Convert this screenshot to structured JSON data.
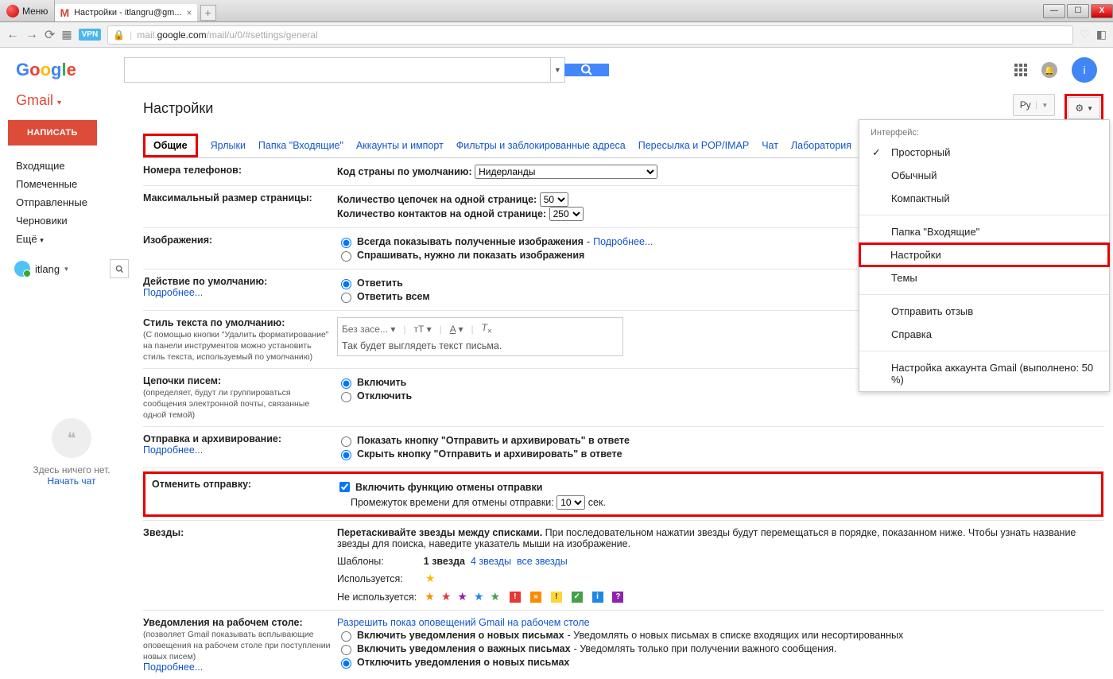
{
  "browser": {
    "menu_label": "Меню",
    "tab_title": "Настройки - itlangru@gm...",
    "url_prefix": "mail.",
    "url_domain": "google.com",
    "url_path": "/mail/u/0/#settings/general",
    "vpn": "VPN"
  },
  "header": {
    "apps_tooltip": "Приложения",
    "avatar_initial": "i"
  },
  "sidebar": {
    "brand": "Gmail",
    "compose": "НАПИСАТЬ",
    "items": [
      "Входящие",
      "Помеченные",
      "Отправленные",
      "Черновики"
    ],
    "more": "Ещё",
    "user": "itlang",
    "hangouts_empty": "Здесь ничего нет.",
    "hangouts_start": "Начать чат"
  },
  "topbar": {
    "title": "Настройки",
    "lang": "Ру"
  },
  "gear_menu": {
    "interface": "Интерфейс:",
    "items1": [
      "Просторный",
      "Обычный",
      "Компактный"
    ],
    "items2": [
      "Папка \"Входящие\"",
      "Настройки",
      "Темы"
    ],
    "items3": [
      "Отправить отзыв",
      "Справка"
    ],
    "items4": "Настройка аккаунта Gmail (выполнено: 50 %)"
  },
  "tabs": [
    "Общие",
    "Ярлыки",
    "Папка \"Входящие\"",
    "Аккаунты и импорт",
    "Фильтры и заблокированные адреса",
    "Пересылка и POP/IMAP",
    "Чат",
    "Лаборатория"
  ],
  "settings": {
    "phone": {
      "label": "Номера телефонов:",
      "code_label": "Код страны по умолчанию:",
      "country": "Нидерланды"
    },
    "pagesize": {
      "label": "Максимальный размер страницы:",
      "threads": "Количество цепочек на одной странице:",
      "threads_v": "50",
      "contacts": "Количество контактов на одной странице:",
      "contacts_v": "250"
    },
    "images": {
      "label": "Изображения:",
      "always": "Всегда показывать полученные изображения",
      "ask": "Спрашивать, нужно ли показать изображения",
      "more": "Подробнее..."
    },
    "default_action": {
      "label": "Действие по умолчанию:",
      "more": "Подробнее...",
      "reply": "Ответить",
      "reply_all": "Ответить всем"
    },
    "text_style": {
      "label": "Стиль текста по умолчанию:",
      "hint": "(С помощью кнопки \"Удалить форматирование\" на панели инструментов можно установить стиль текста, используемый по умолчанию)",
      "font": "Без засе...",
      "sample": "Так будет выглядеть текст письма."
    },
    "threads": {
      "label": "Цепочки писем:",
      "hint": "(определяет, будут ли группироваться сообщения электронной почты, связанные одной темой)",
      "on": "Включить",
      "off": "Отключить"
    },
    "archive": {
      "label": "Отправка и архивирование:",
      "more": "Подробнее...",
      "show": "Показать кнопку \"Отправить и архивировать\" в ответе",
      "hide": "Скрыть кнопку \"Отправить и архивировать\" в ответе"
    },
    "undo": {
      "label": "Отменить отправку:",
      "enable": "Включить функцию отмены отправки",
      "period_label": "Промежуток времени для отмены отправки:",
      "seconds": "10",
      "sec_unit": "сек."
    },
    "stars": {
      "label": "Звезды:",
      "desc1": "Перетаскивайте звезды между списками.",
      "desc2": " При последовательном нажатии звезды будут перемещаться в порядке, показанном ниже. Чтобы узнать название звезды для поиска, наведите указатель мыши на изображение.",
      "templates": "Шаблоны:",
      "one": "1 звезда",
      "four": "4 звезды",
      "all": "все звезды",
      "used": "Используется:",
      "unused": "Не используется:"
    },
    "notifications": {
      "label": "Уведомления на рабочем столе:",
      "hint": "(позволяет Gmail показывать всплывающие оповещения на рабочем столе при поступлении новых писем)",
      "more": "Подробнее...",
      "allow": "Разрешить показ оповещений Gmail на рабочем столе",
      "opt1": "Включить уведомления о новых письмах",
      "opt1_desc": " - Уведомлять о новых письмах в списке входящих или несортированных",
      "opt2": "Включить уведомления о важных письмах",
      "opt2_desc": " - Уведомлять только при получении важного сообщения.",
      "opt3": "Отключить уведомления о новых письмах"
    }
  }
}
